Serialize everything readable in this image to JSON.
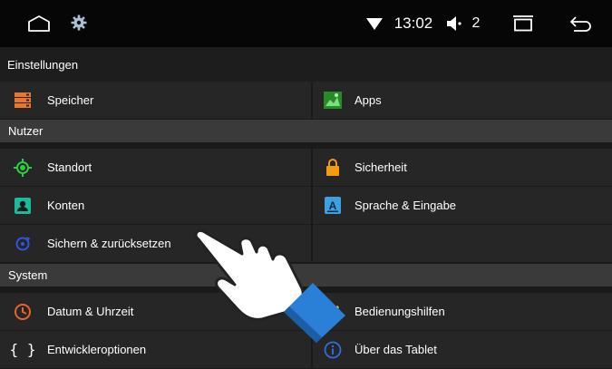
{
  "status": {
    "time": "13:02",
    "volume": "2"
  },
  "title": "Einstellungen",
  "sections": {
    "nutzer": "Nutzer",
    "system": "System"
  },
  "items": {
    "speicher": "Speicher",
    "apps": "Apps",
    "standort": "Standort",
    "sicherheit": "Sicherheit",
    "konten": "Konten",
    "sprache": "Sprache & Eingabe",
    "sichern": "Sichern & zurücksetzen",
    "datum": "Datum & Uhrzeit",
    "bedienung": "Bedienungshilfen",
    "entwickler": "Entwickleroptionen",
    "tablet": "Über das Tablet"
  },
  "icons": {
    "speicher": "storage-icon",
    "apps": "apps-icon",
    "standort": "location-icon",
    "sicherheit": "lock-icon",
    "konten": "account-icon",
    "sprache": "language-icon",
    "sichern": "backup-icon",
    "datum": "clock-icon",
    "bedienung": "accessibility-icon",
    "entwickler": "developer-braces-icon",
    "tablet": "info-icon"
  },
  "colors": {
    "background": "#1a1a1a",
    "row": "#262626",
    "section_header": "#3a3a3a",
    "statusbar": "#060606"
  }
}
